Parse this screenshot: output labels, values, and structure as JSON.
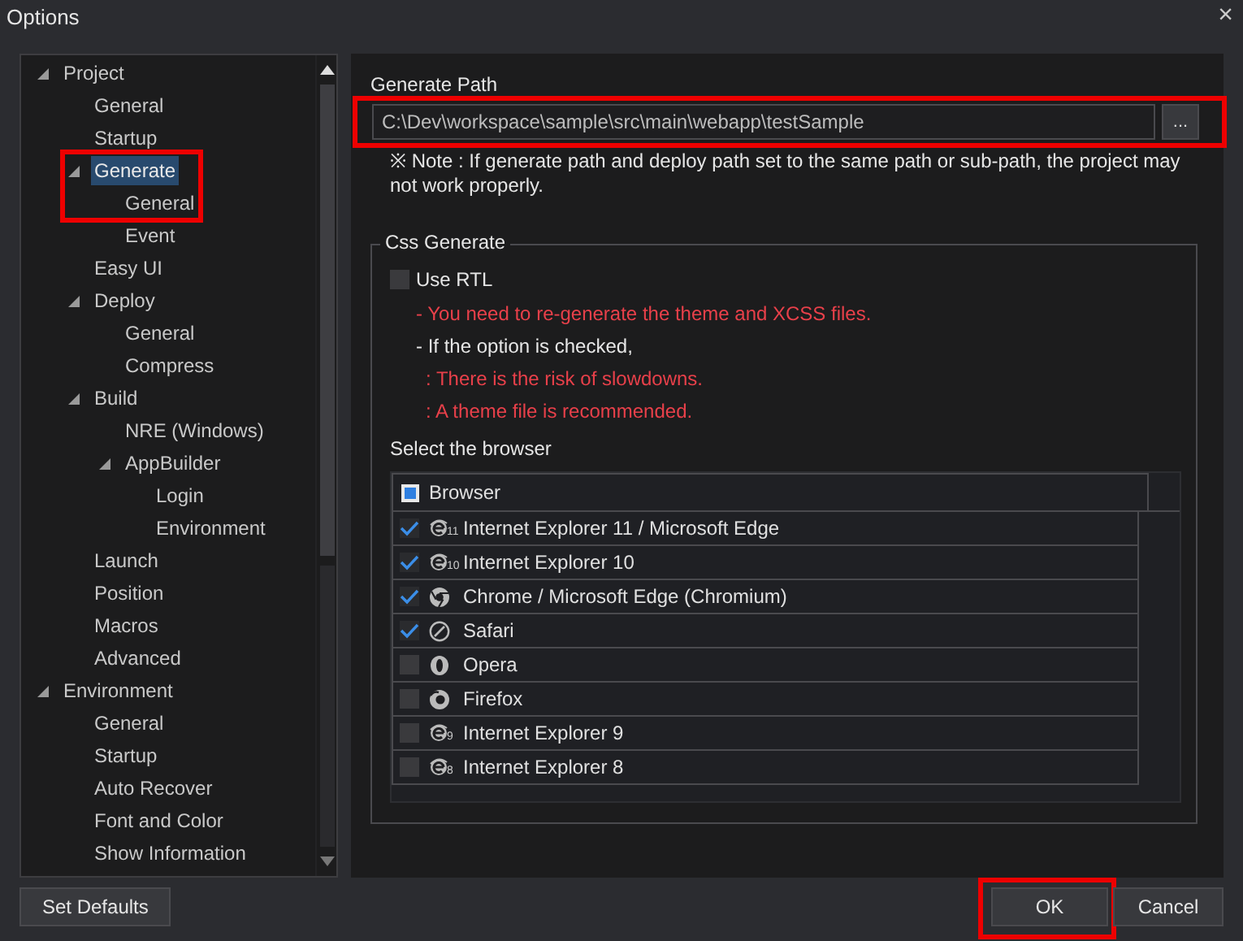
{
  "window": {
    "title": "Options",
    "close": "×"
  },
  "tree": [
    {
      "label": "Project",
      "expanded": true,
      "selected": false,
      "highlighted": false,
      "children": [
        {
          "label": "General",
          "selected": false,
          "highlighted": false
        },
        {
          "label": "Startup",
          "selected": false,
          "highlighted": false
        },
        {
          "label": "Generate",
          "expanded": true,
          "selected": true,
          "highlighted": true,
          "children": [
            {
              "label": "General",
              "selected": false,
              "highlighted": false
            },
            {
              "label": "Event",
              "selected": false,
              "highlighted": false
            }
          ]
        },
        {
          "label": "Easy UI",
          "selected": false,
          "highlighted": false
        },
        {
          "label": "Deploy",
          "expanded": true,
          "selected": false,
          "highlighted": false,
          "children": [
            {
              "label": "General",
              "selected": false,
              "highlighted": false
            },
            {
              "label": "Compress",
              "selected": false,
              "highlighted": false
            }
          ]
        },
        {
          "label": "Build",
          "expanded": true,
          "selected": false,
          "highlighted": false,
          "children": [
            {
              "label": "NRE (Windows)",
              "selected": false,
              "highlighted": false
            },
            {
              "label": "AppBuilder",
              "expanded": true,
              "selected": false,
              "highlighted": false,
              "children": [
                {
                  "label": "Login",
                  "selected": false,
                  "highlighted": false
                },
                {
                  "label": "Environment",
                  "selected": false,
                  "highlighted": false
                }
              ]
            }
          ]
        },
        {
          "label": "Launch",
          "selected": false,
          "highlighted": false
        },
        {
          "label": "Position",
          "selected": false,
          "highlighted": false
        },
        {
          "label": "Macros",
          "selected": false,
          "highlighted": false
        },
        {
          "label": "Advanced",
          "selected": false,
          "highlighted": false
        }
      ]
    },
    {
      "label": "Environment",
      "expanded": true,
      "selected": false,
      "highlighted": false,
      "children": [
        {
          "label": "General",
          "selected": false,
          "highlighted": false
        },
        {
          "label": "Startup",
          "selected": false,
          "highlighted": false
        },
        {
          "label": "Auto Recover",
          "selected": false,
          "highlighted": false
        },
        {
          "label": "Font and Color",
          "selected": false,
          "highlighted": false
        },
        {
          "label": "Show Information",
          "selected": false,
          "highlighted": false
        }
      ]
    }
  ],
  "generate_path": {
    "label": "Generate Path",
    "value": "C:\\Dev\\workspace\\sample\\src\\main\\webapp\\testSample",
    "browse_button": "...",
    "highlighted": true,
    "note": "※ Note : If generate path and deploy path set to the same path or sub-path, the project may not work properly."
  },
  "css_generate": {
    "title": "Css Generate",
    "use_rtl": {
      "label": "Use RTL",
      "checked": false
    },
    "notes": [
      {
        "kind": "warning",
        "text": "- You need to re-generate the theme and XCSS files."
      },
      {
        "kind": "info",
        "text": "- If the option is checked,",
        "children": [
          {
            "kind": "warning",
            "text": ": There is the risk of slowdowns."
          },
          {
            "kind": "warning",
            "text": ": A theme file is recommended."
          }
        ]
      }
    ],
    "browser_label": "Select the browser",
    "browser_table": {
      "header": {
        "label": "Browser",
        "mixed": true
      },
      "rows": [
        {
          "label": "Internet Explorer 11 / Microsoft Edge",
          "checked": true,
          "kind": "ie",
          "version": "11"
        },
        {
          "label": "Internet Explorer 10",
          "checked": true,
          "kind": "ie",
          "version": "10"
        },
        {
          "label": "Chrome / Microsoft Edge (Chromium)",
          "checked": true,
          "kind": "chrome"
        },
        {
          "label": "Safari",
          "checked": true,
          "kind": "safari"
        },
        {
          "label": "Opera",
          "checked": false,
          "kind": "opera"
        },
        {
          "label": "Firefox",
          "checked": false,
          "kind": "firefox"
        },
        {
          "label": "Internet Explorer 9",
          "checked": false,
          "kind": "ie",
          "version": "9"
        },
        {
          "label": "Internet Explorer 8",
          "checked": false,
          "kind": "ie",
          "version": "8"
        }
      ]
    }
  },
  "buttons": [
    {
      "label": "Set Defaults",
      "highlighted": false
    },
    {
      "label": "OK",
      "highlighted": true
    },
    {
      "label": "Cancel",
      "highlighted": false
    }
  ]
}
